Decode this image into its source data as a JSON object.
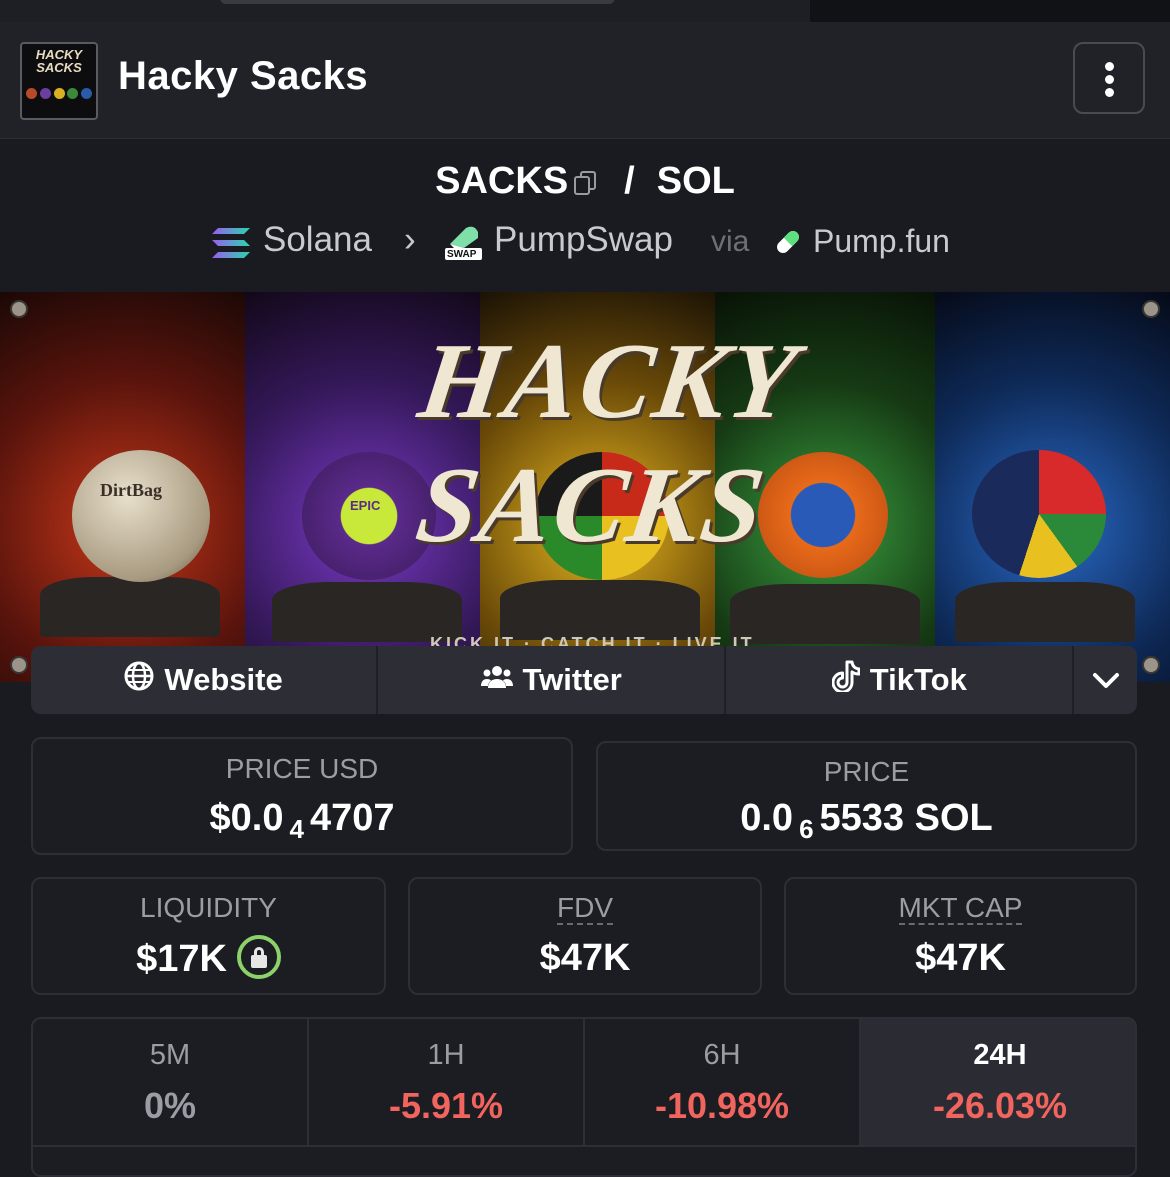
{
  "app": {
    "title": "Hacky Sacks",
    "avatar_text": "HACKY SACKS"
  },
  "pair": {
    "base": "SACKS",
    "separator": "/",
    "quote": "SOL"
  },
  "route": {
    "chain": "Solana",
    "arrow": "›",
    "dex": "PumpSwap",
    "dex_badge": "SWAP",
    "via": "via",
    "launchpad": "Pump.fun"
  },
  "banner": {
    "title": "HACKY SACKS",
    "ball_label_1": "DirtBag",
    "ball_label_2": "EPIC",
    "tagline": "KICK IT · CATCH IT · LIVE IT"
  },
  "links": {
    "website": "Website",
    "twitter": "Twitter",
    "tiktok": "TikTok"
  },
  "stats": {
    "price_usd_label": "PRICE USD",
    "price_usd_prefix": "$0.0",
    "price_usd_sub": "4",
    "price_usd_suffix": "4707",
    "price_label": "PRICE",
    "price_prefix": "0.0",
    "price_sub": "6",
    "price_suffix": "5533 SOL",
    "liquidity_label": "LIQUIDITY",
    "liquidity_value": "$17K",
    "fdv_label": "FDV",
    "fdv_value": "$47K",
    "mkt_cap_label": "MKT CAP",
    "mkt_cap_value": "$47K"
  },
  "changes": [
    {
      "period": "5M",
      "value": "0%",
      "color": "#9c9da4"
    },
    {
      "period": "1H",
      "value": "-5.91%",
      "color": "#f2645e"
    },
    {
      "period": "6H",
      "value": "-10.98%",
      "color": "#f2645e"
    },
    {
      "period": "24H",
      "value": "-26.03%",
      "color": "#f2645e"
    }
  ],
  "colors": {
    "accent_lock": "#8dd16a",
    "negative": "#f2645e",
    "background": "#1a1b20"
  }
}
